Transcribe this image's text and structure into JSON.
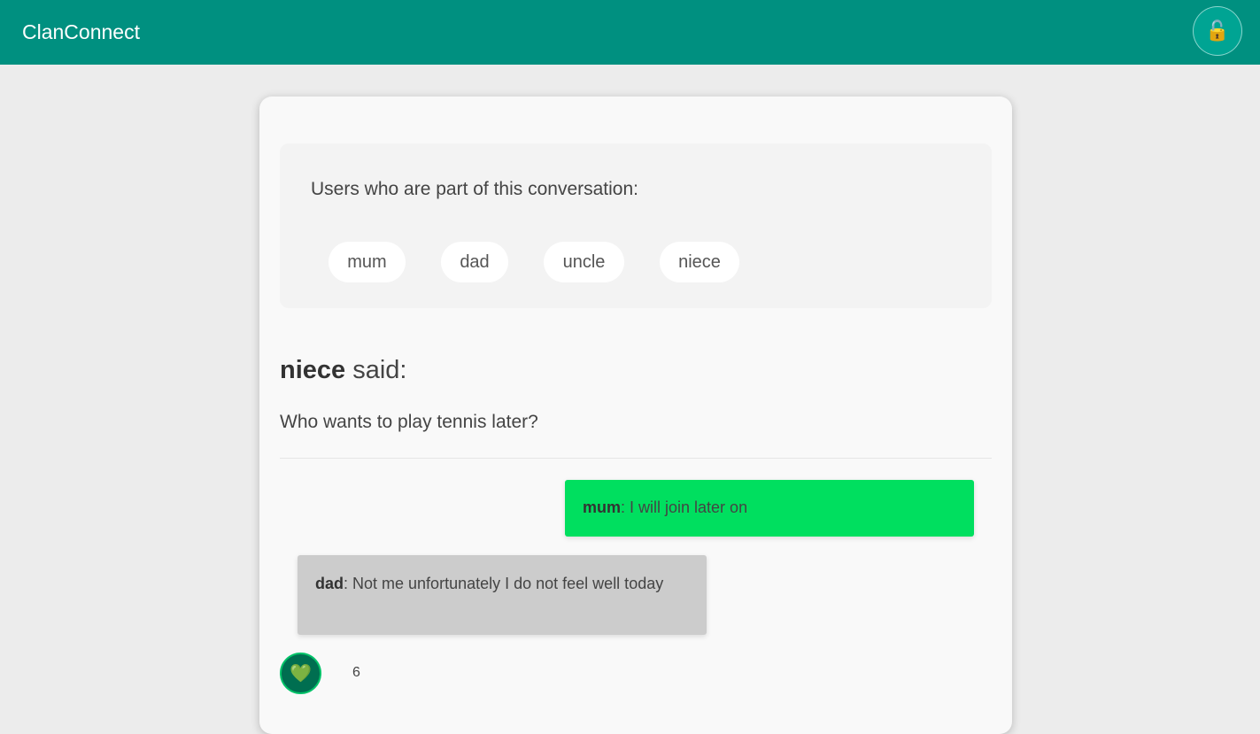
{
  "header": {
    "brand": "ClanConnect",
    "lock_icon": "🔓"
  },
  "members": {
    "title": "Users who are part of this conversation:",
    "users": [
      "mum",
      "dad",
      "uncle",
      "niece"
    ]
  },
  "post": {
    "author": "niece",
    "said_suffix": " said:",
    "message": "Who wants to play tennis later?"
  },
  "replies": [
    {
      "author": "mum",
      "text": ": I will join later on",
      "color": "#00df5f"
    },
    {
      "author": "dad",
      "text": ": Not me unfortunately I do not feel well today",
      "color": "#cccccc"
    }
  ],
  "reaction": {
    "icon": "💚",
    "count": "6"
  },
  "colors": {
    "header": "#009080",
    "accent": "#00df5f"
  }
}
